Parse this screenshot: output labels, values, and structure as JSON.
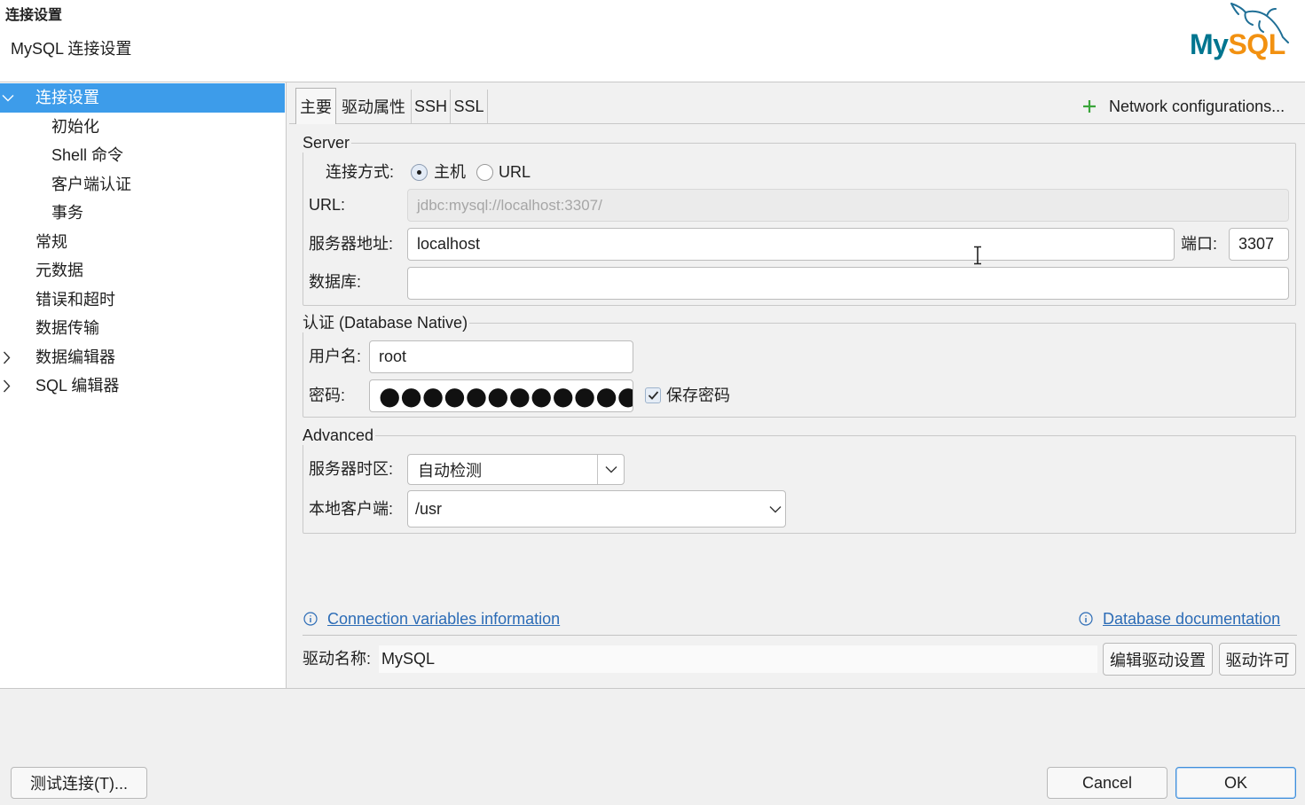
{
  "header": {
    "title": "连接设置",
    "subtitle": "MySQL 连接设置",
    "logo": {
      "part1": "My",
      "part2": "SQL"
    }
  },
  "sidebar": {
    "items": [
      {
        "label": "连接设置",
        "selected": true,
        "expanded": true,
        "children": [
          {
            "label": "初始化"
          },
          {
            "label": "Shell 命令"
          },
          {
            "label": "客户端认证"
          },
          {
            "label": "事务"
          }
        ]
      },
      {
        "label": "常规"
      },
      {
        "label": "元数据"
      },
      {
        "label": "错误和超时"
      },
      {
        "label": "数据传输"
      },
      {
        "label": "数据编辑器",
        "expanded": false
      },
      {
        "label": "SQL 编辑器",
        "expanded": false
      }
    ]
  },
  "tabs": [
    {
      "label": "主要",
      "selected": true
    },
    {
      "label": "驱动属性",
      "selected": false
    },
    {
      "label": "SSH",
      "selected": false
    },
    {
      "label": "SSL",
      "selected": false
    }
  ],
  "network_config": {
    "label": "Network configurations..."
  },
  "server": {
    "title": "Server",
    "connection_mode": {
      "label": "连接方式:",
      "options": [
        {
          "label": "主机",
          "selected": true
        },
        {
          "label": "URL",
          "selected": false
        }
      ]
    },
    "url": {
      "label": "URL:",
      "value": "jdbc:mysql://localhost:3307/",
      "enabled": false
    },
    "host": {
      "label": "服务器地址:",
      "value": "localhost"
    },
    "port": {
      "label": "端口:",
      "value": "3307"
    },
    "database": {
      "label": "数据库:",
      "value": ""
    }
  },
  "auth": {
    "title": "认证 (Database Native)",
    "username": {
      "label": "用户名:",
      "value": "root"
    },
    "password": {
      "label": "密码:",
      "masked_value": "●●●●●●●●●●●●●●●●"
    },
    "save_password": {
      "label": "保存密码",
      "checked": true
    }
  },
  "advanced": {
    "title": "Advanced",
    "server_timezone": {
      "label": "服务器时区:",
      "value": "自动检测"
    },
    "local_client": {
      "label": "本地客户端:",
      "value": "/usr"
    }
  },
  "links": {
    "connection_variables": "Connection variables information",
    "database_documentation": "Database documentation"
  },
  "driver": {
    "label": "驱动名称:",
    "name": "MySQL",
    "edit_button": "编辑驱动设置",
    "license_button": "驱动许可"
  },
  "footer": {
    "test_connection_button": "测试连接(T)...",
    "cancel_button": "Cancel",
    "ok_button": "OK"
  },
  "colors": {
    "accent": "#3d9cea",
    "link": "#2c6cb6",
    "add_icon": "#3aa53a",
    "logo_my": "#00758f",
    "logo_sql": "#f29111",
    "panel_bg": "#f1f1f1"
  },
  "icons": {
    "tree_expanded": "chevron-down-icon",
    "tree_collapsed": "chevron-right-icon",
    "add": "plus-icon",
    "info": "info-icon",
    "dropdown": "chevron-down-icon",
    "checkbox": "checkmark-icon",
    "logo": "dolphin-icon",
    "cursor": "text-cursor-icon"
  }
}
